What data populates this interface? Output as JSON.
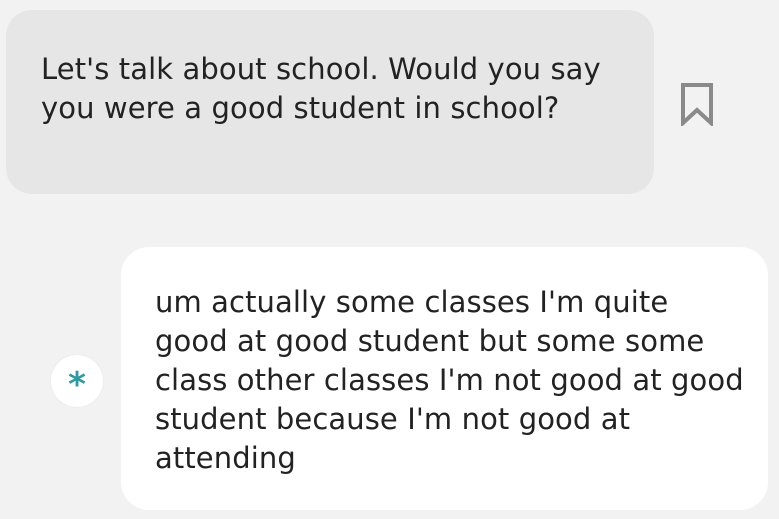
{
  "conversation": {
    "bot_message": {
      "text": "Let's talk about school. Would you say you were a good student in school?"
    },
    "bookmark": {
      "icon": "bookmark-icon"
    },
    "user_message": {
      "text": "um actually some classes I'm quite good at good student but some some class other classes I'm not good at good student because I'm not good at attending"
    },
    "avatar": {
      "icon": "asterisk-icon",
      "glyph": "*",
      "color": "#2a9ba4"
    }
  },
  "colors": {
    "background": "#f2f2f2",
    "bot_bubble": "#e6e6e6",
    "user_bubble": "#ffffff",
    "text": "#222222",
    "icon_gray": "#8a8a8a",
    "accent": "#2a9ba4"
  }
}
